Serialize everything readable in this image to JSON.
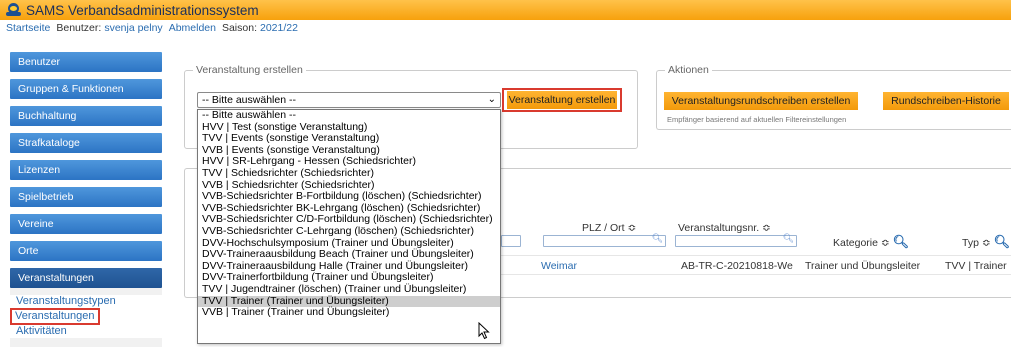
{
  "app": {
    "title": "SAMS Verbandsadministrationssystem",
    "logo_icon": "volleyball-logo"
  },
  "topnav": {
    "home": "Startseite",
    "user_label": "Benutzer:",
    "user_name": "svenja pelny",
    "logout": "Abmelden",
    "season_label": "Saison:",
    "season_value": "2021/22"
  },
  "sidebar": {
    "items": [
      {
        "label": "Benutzer"
      },
      {
        "label": "Gruppen & Funktionen"
      },
      {
        "label": "Buchhaltung"
      },
      {
        "label": "Strafkataloge"
      },
      {
        "label": "Lizenzen"
      },
      {
        "label": "Spielbetrieb"
      },
      {
        "label": "Vereine"
      },
      {
        "label": "Orte"
      },
      {
        "label": "Veranstaltungen"
      }
    ],
    "subitems": [
      {
        "label": "Veranstaltungstypen"
      },
      {
        "label": "Veranstaltungen"
      },
      {
        "label": "Aktivitäten"
      }
    ]
  },
  "create_panel": {
    "legend": "Veranstaltung erstellen",
    "select_value": "-- Bitte auswählen --",
    "create_button": "Veranstaltung erstellen"
  },
  "actions_panel": {
    "legend": "Aktionen",
    "rundschreiben_button": "Veranstaltungsrundschreiben erstellen",
    "history_button": "Rundschreiben-Historie",
    "note": "Empfänger basierend auf aktuellen Filtereinstellungen"
  },
  "dropdown_options": [
    "-- Bitte auswählen --",
    "HVV | Test (sonstige Veranstaltung)",
    "TVV | Events (sonstige Veranstaltung)",
    "VVB | Events (sonstige Veranstaltung)",
    "HVV | SR-Lehrgang - Hessen (Schiedsrichter)",
    "TVV | Schiedsrichter (Schiedsrichter)",
    "VVB | Schiedsrichter (Schiedsrichter)",
    "VVB-Schiedsrichter B-Fortbildung (löschen) (Schiedsrichter)",
    "VVB-Schiedsrichter BK-Lehrgang (löschen) (Schiedsrichter)",
    "VVB-Schiedsrichter C/D-Fortbildung (löschen) (Schiedsrichter)",
    "VVB-Schiedsrichter C-Lehrgang (löschen) (Schiedsrichter)",
    "DVV-Hochschulsymposium (Trainer und Übungsleiter)",
    "DVV-Traineraausbildung Beach (Trainer und Übungsleiter)",
    "DVV-Traineraausbildung Halle (Trainer und Übungsleiter)",
    "DVV-Trainerfortbildung (Trainer und Übungsleiter)",
    "TVV | Jugendtrainer (löschen) (Trainer und Übungsleiter)",
    "TVV | Trainer (Trainer und Übungsleiter)",
    "VVB | Trainer (Trainer und Übungsleiter)"
  ],
  "table": {
    "headers": {
      "plz_ort": "PLZ / Ort ≎",
      "nr": "Veranstaltungsnr. ≎",
      "kategorie": "Kategorie ≎",
      "typ": "Typ ≎"
    },
    "row": {
      "ort": "Weimar",
      "nr": "AB-TR-C-20210818-We",
      "kategorie": "Trainer und Übungsleiter",
      "typ": "TVV | Trainer"
    }
  }
}
